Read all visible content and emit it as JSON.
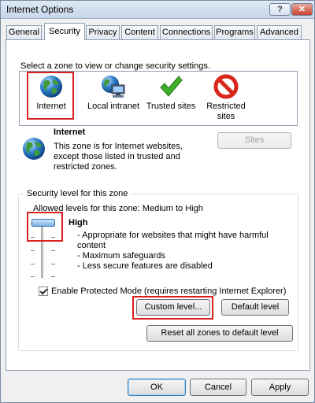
{
  "window": {
    "title": "Internet Options",
    "help_glyph": "?",
    "close_glyph": "✕"
  },
  "tabs": [
    {
      "label": "General"
    },
    {
      "label": "Security"
    },
    {
      "label": "Privacy"
    },
    {
      "label": "Content"
    },
    {
      "label": "Connections"
    },
    {
      "label": "Programs"
    },
    {
      "label": "Advanced"
    }
  ],
  "zones": {
    "prompt": "Select a zone to view or change security settings.",
    "items": [
      {
        "label": "Internet",
        "icon": "globe-icon"
      },
      {
        "label": "Local intranet",
        "icon": "intranet-icon"
      },
      {
        "label": "Trusted sites",
        "icon": "checkmark-icon"
      },
      {
        "label": "Restricted sites",
        "icon": "prohibited-icon"
      }
    ],
    "selected": "Internet"
  },
  "zone_info": {
    "name": "Internet",
    "description": "This zone is for Internet websites, except those listed in trusted and restricted zones.",
    "sites_button": "Sites"
  },
  "security_level": {
    "group_title": "Security level for this zone",
    "allowed": "Allowed levels for this zone: Medium to High",
    "level": "High",
    "bullets": [
      "- Appropriate for websites that might have harmful content",
      "- Maximum safeguards",
      "- Less secure features are disabled"
    ],
    "slider_level": "High"
  },
  "protected_mode": {
    "label": "Enable Protected Mode (requires restarting Internet Explorer)",
    "checked": true
  },
  "buttons": {
    "custom_level": "Custom level...",
    "default_level": "Default level",
    "reset_all": "Reset all zones to default level",
    "ok": "OK",
    "cancel": "Cancel",
    "apply": "Apply"
  },
  "colors": {
    "highlight": "#d7201f",
    "checkmark": "#3fae2a",
    "prohibited": "#d9261c",
    "globe": "#2f7fc9"
  }
}
